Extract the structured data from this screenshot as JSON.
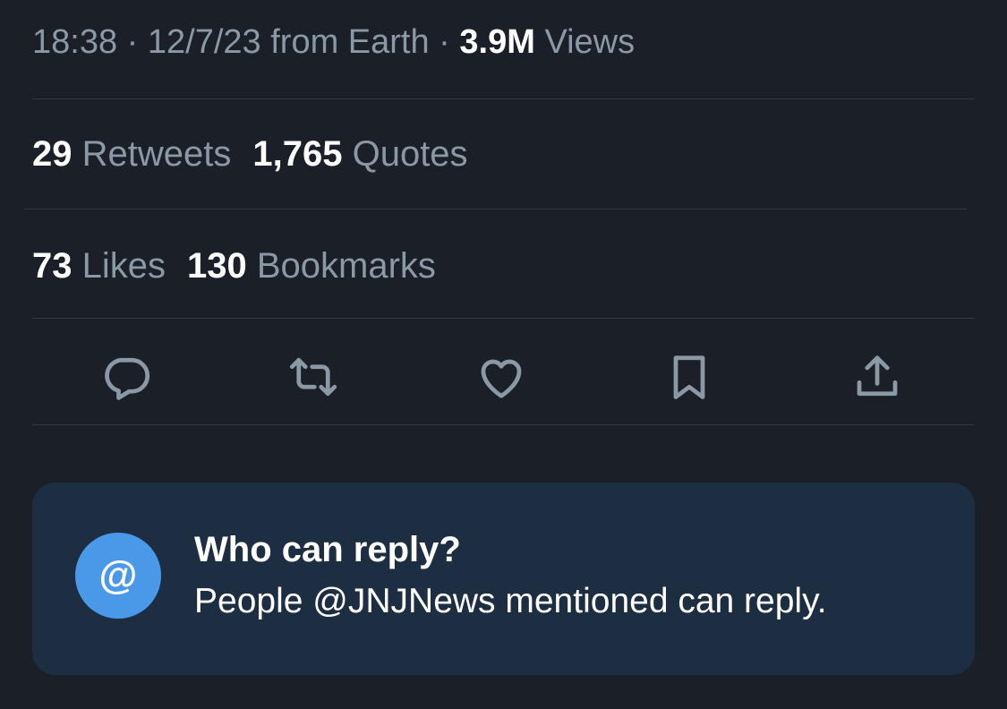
{
  "meta": {
    "time": "18:38",
    "separator1": " · ",
    "date": "12/7/23",
    "source": " from Earth",
    "separator2": " · ",
    "views_count": "3.9M",
    "views_label": " Views"
  },
  "stats_row1": {
    "retweets_count": "29",
    "retweets_label": " Retweets",
    "quotes_count": "1,765",
    "quotes_label": " Quotes"
  },
  "stats_row2": {
    "likes_count": "73",
    "likes_label": " Likes",
    "bookmarks_count": "130",
    "bookmarks_label": " Bookmarks"
  },
  "actions": {
    "icons": [
      "reply-icon",
      "retweet-icon",
      "like-icon",
      "bookmark-icon",
      "share-icon"
    ]
  },
  "reply_card": {
    "badge_symbol": "@",
    "title": "Who can reply?",
    "description": "People @JNJNews mentioned can reply."
  },
  "colors": {
    "background": "#1a1f28",
    "secondary_text": "#8b98a5",
    "primary_text": "#ffffff",
    "divider": "#313a45",
    "card_background": "#1d2d42",
    "accent": "#4a99e9"
  }
}
